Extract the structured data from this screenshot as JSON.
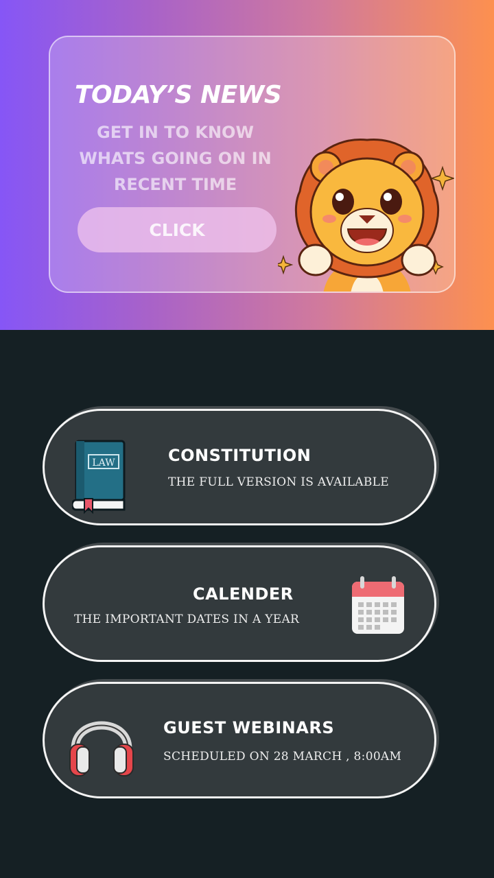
{
  "hero": {
    "title": "TODAY’S NEWS",
    "subtitle_lines": [
      "GET IN TO KNOW",
      "WHATS GOING ON IN",
      "RECENT TIME"
    ],
    "button_label": "CLICK",
    "mascot": "lion-mascot-icon"
  },
  "cards": [
    {
      "title": "CONSTITUTION",
      "subtitle": "THE FULL VERSION IS AVAILABLE",
      "icon": "law-book-icon",
      "icon_text": "LAW"
    },
    {
      "title": "CALENDER",
      "subtitle": "THE IMPORTANT DATES IN A YEAR",
      "icon": "calendar-icon"
    },
    {
      "title": "GUEST WEBINARS",
      "subtitle": "SCHEDULED ON 28 MARCH , 8:00AM",
      "icon": "headphones-icon"
    }
  ],
  "colors": {
    "gradient_start": "#8656f6",
    "gradient_end": "#fd904f",
    "background": "#152024",
    "card": "#333a3d"
  }
}
